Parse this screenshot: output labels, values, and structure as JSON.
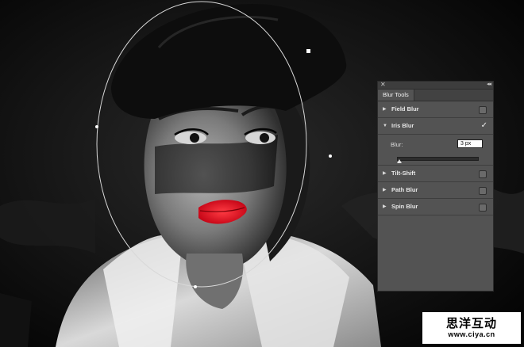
{
  "panel": {
    "tab_title": "Blur Tools",
    "rows": [
      {
        "label": "Field Blur",
        "expanded": false,
        "checked": false
      },
      {
        "label": "Iris Blur",
        "expanded": true,
        "checked": true
      },
      {
        "label": "Tilt-Shift",
        "expanded": false,
        "checked": false
      },
      {
        "label": "Path Blur",
        "expanded": false,
        "checked": false
      },
      {
        "label": "Spin Blur",
        "expanded": false,
        "checked": false
      }
    ],
    "iris": {
      "blur_label": "Blur:",
      "blur_value": "3 px",
      "slider_fraction": 0.03
    }
  },
  "icons": {
    "close": "close-icon",
    "collapse": "collapse-icon",
    "expand": "triangle-right-icon",
    "collapse_row": "triangle-down-icon",
    "check": "checkmark-icon"
  },
  "watermark": {
    "title": "思洋互动",
    "url": "www.ciya.cn"
  },
  "colors": {
    "lips": "#e0101f",
    "panel_bg": "#535353",
    "panel_border": "#2b2b2b"
  }
}
